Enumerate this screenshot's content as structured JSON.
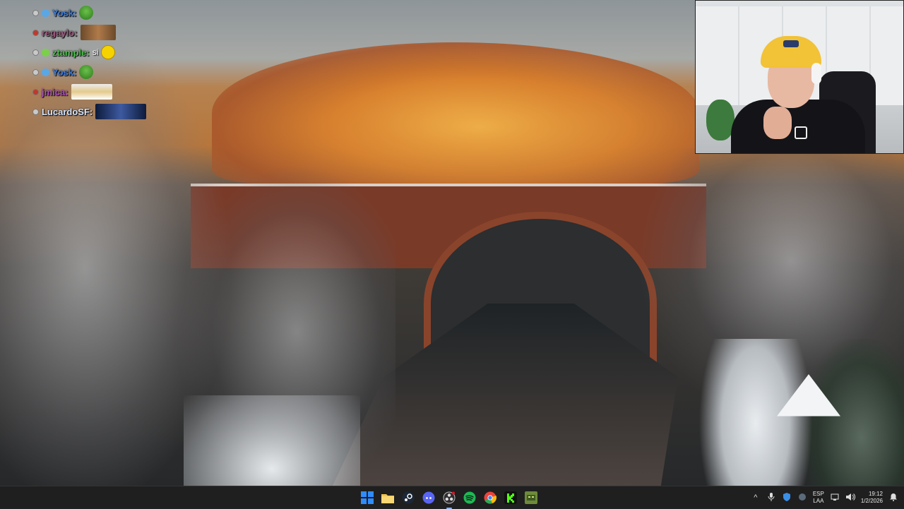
{
  "chat": [
    {
      "username": "Yosk:",
      "color": "#3b7de0",
      "badge": "twitter-bird-badge",
      "badge_color": "#5aa7e6",
      "emote": "pepe-emote",
      "message": ""
    },
    {
      "username": "regaylo:",
      "color": "#a05a80",
      "badge": "",
      "badge_color": "",
      "emote": "faces-emote",
      "message": ""
    },
    {
      "username": "ztample:",
      "color": "#4fc04f",
      "badge": "crown-badge",
      "badge_color": "#7bd04a",
      "emote": "smiley-emote",
      "message": "si"
    },
    {
      "username": "Yosk:",
      "color": "#3b7de0",
      "badge": "twitter-bird-badge",
      "badge_color": "#5aa7e6",
      "emote": "pepe-emote",
      "message": ""
    },
    {
      "username": "jmica:",
      "color": "#b050c0",
      "badge": "",
      "badge_color": "",
      "emote": "meme-emote",
      "message": ""
    },
    {
      "username": "LucardoSF:",
      "color": "#d7e6ff",
      "badge": "",
      "badge_color": "",
      "emote": "video-emote",
      "message": ""
    }
  ],
  "taskbar": {
    "apps": [
      {
        "name": "windows-start-icon",
        "color": "#2f8cff"
      },
      {
        "name": "file-explorer-icon",
        "color": "#f2c44a"
      },
      {
        "name": "steam-icon",
        "color": "#2a475e"
      },
      {
        "name": "discord-icon",
        "color": "#5865f2"
      },
      {
        "name": "obs-icon",
        "color": "#3a3a3a"
      },
      {
        "name": "spotify-icon",
        "color": "#1db954"
      },
      {
        "name": "chrome-icon",
        "color": "#e8453c"
      },
      {
        "name": "kick-icon",
        "color": "#53fc18"
      },
      {
        "name": "game-icon",
        "color": "#6d8b3a"
      }
    ],
    "language_top": "ESP",
    "language_bottom": "LAA",
    "time": "19:12",
    "date": "1/2/2026"
  }
}
